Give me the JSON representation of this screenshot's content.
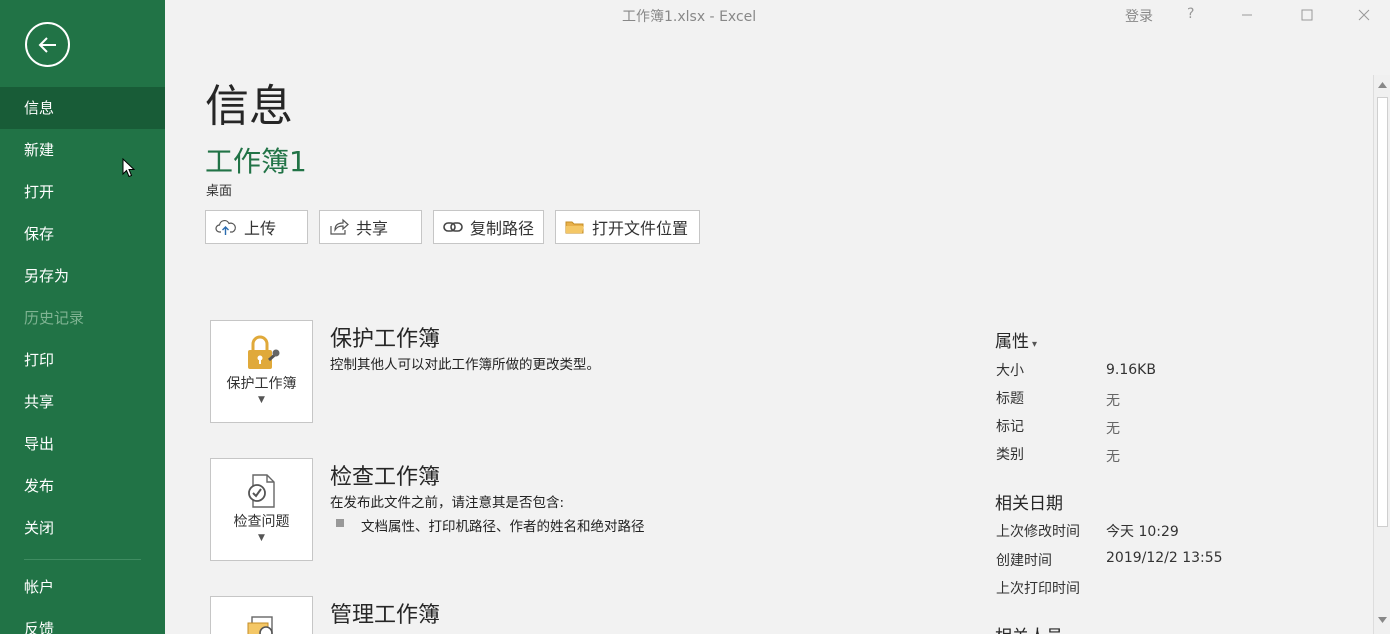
{
  "window": {
    "title": "工作簿1.xlsx  -  Excel",
    "login_label": "登录",
    "help_label": "?"
  },
  "sidebar": {
    "items": [
      {
        "label": "信息",
        "state": "active"
      },
      {
        "label": "新建",
        "state": "normal"
      },
      {
        "label": "打开",
        "state": "normal"
      },
      {
        "label": "保存",
        "state": "normal"
      },
      {
        "label": "另存为",
        "state": "normal"
      },
      {
        "label": "历史记录",
        "state": "disabled"
      },
      {
        "label": "打印",
        "state": "normal"
      },
      {
        "label": "共享",
        "state": "normal"
      },
      {
        "label": "导出",
        "state": "normal"
      },
      {
        "label": "发布",
        "state": "normal"
      },
      {
        "label": "关闭",
        "state": "normal"
      }
    ],
    "bottom_items": [
      {
        "label": "帐户"
      },
      {
        "label": "反馈"
      }
    ]
  },
  "info": {
    "page_title": "信息",
    "workbook_name": "工作簿1",
    "location": "桌面",
    "actions": {
      "upload": "上传",
      "share": "共享",
      "copy_path": "复制路径",
      "open_location": "打开文件位置"
    }
  },
  "sections": {
    "protect": {
      "tile_label": "保护工作簿",
      "title": "保护工作簿",
      "description": "控制其他人可以对此工作簿所做的更改类型。"
    },
    "inspect": {
      "tile_label": "检查问题",
      "title": "检查工作簿",
      "description": "在发布此文件之前，请注意其是否包含:",
      "bullet": "文档属性、打印机路径、作者的姓名和绝对路径"
    },
    "manage": {
      "title": "管理工作簿"
    }
  },
  "properties": {
    "title": "属性",
    "rows": {
      "size": {
        "label": "大小",
        "value": "9.16KB"
      },
      "title": {
        "label": "标题",
        "value": "无"
      },
      "tags": {
        "label": "标记",
        "value": "无"
      },
      "category": {
        "label": "类别",
        "value": "无"
      }
    },
    "dates_title": "相关日期",
    "dates": {
      "modified": {
        "label": "上次修改时间",
        "value": "今天 10:29"
      },
      "created": {
        "label": "创建时间",
        "value": "2019/12/2 13:55"
      },
      "printed": {
        "label": "上次打印时间"
      }
    },
    "people_title": "相关人员"
  },
  "colors": {
    "brand": "#217346",
    "sidebar_active": "#185c37",
    "sidebar_disabled": "#7fb392",
    "accent_icon": "#e0a93a"
  }
}
